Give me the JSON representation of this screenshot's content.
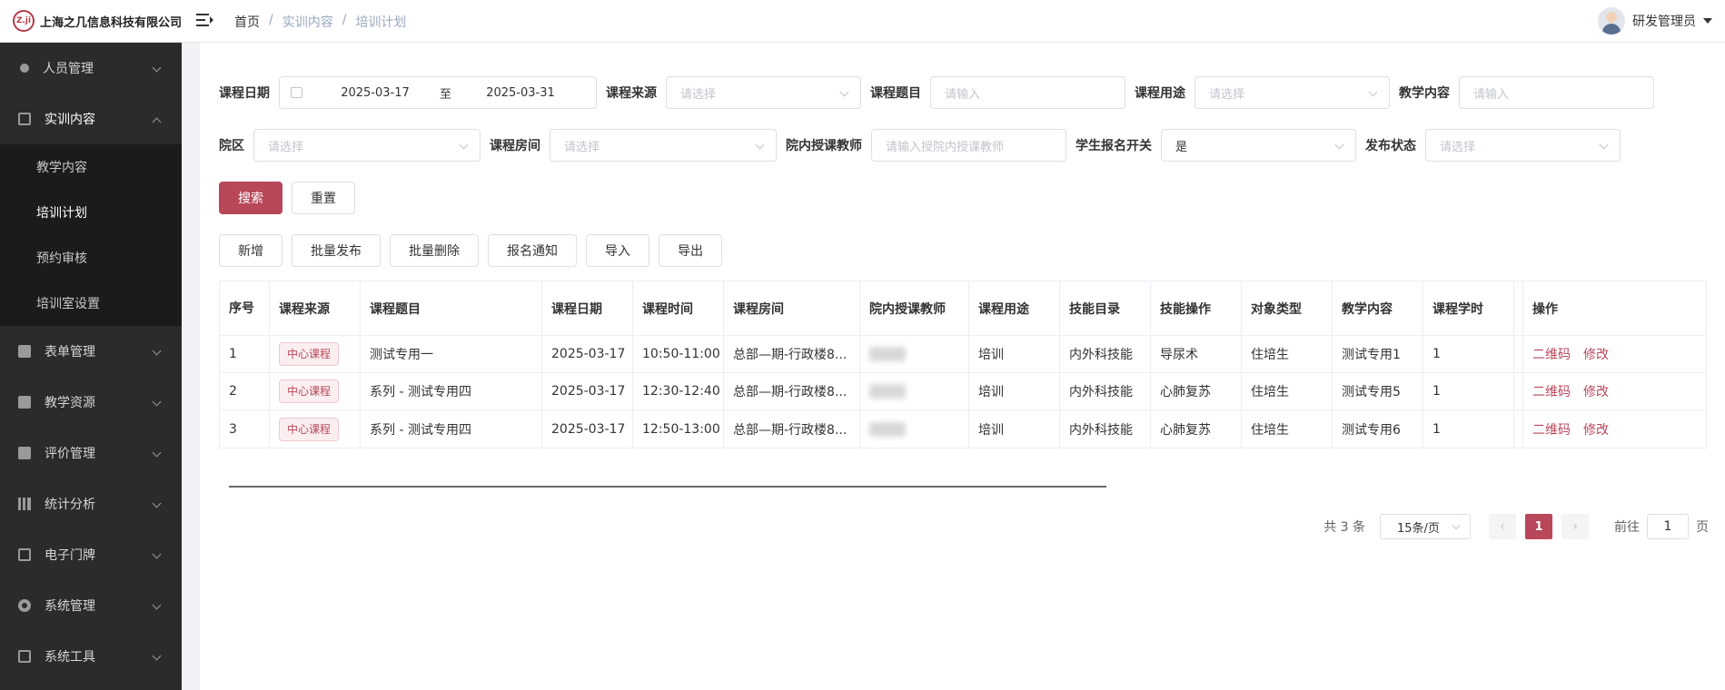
{
  "company": {
    "logo_mark": "Z.ji",
    "name": "上海之几信息科技有限公司"
  },
  "breadcrumb": {
    "home": "首页",
    "sep": "/",
    "mid": "实训内容",
    "current": "培训计划"
  },
  "user": {
    "name": "研发管理员"
  },
  "sidebar": {
    "items": [
      {
        "label": "人员管理"
      },
      {
        "label": "实训内容"
      },
      {
        "label": "表单管理"
      },
      {
        "label": "教学资源"
      },
      {
        "label": "评价管理"
      },
      {
        "label": "统计分析"
      },
      {
        "label": "电子门牌"
      },
      {
        "label": "系统管理"
      },
      {
        "label": "系统工具"
      }
    ],
    "submenu": [
      {
        "label": "教学内容"
      },
      {
        "label": "培训计划"
      },
      {
        "label": "预约审核"
      },
      {
        "label": "培训室设置"
      }
    ]
  },
  "filters": {
    "course_date_label": "课程日期",
    "date_start": "2025-03-17",
    "date_to": "至",
    "date_end": "2025-03-31",
    "source_label": "课程来源",
    "source_placeholder": "请选择",
    "title_label": "课程题目",
    "title_placeholder": "请输入",
    "purpose_label": "课程用途",
    "purpose_placeholder": "请选择",
    "content_label": "教学内容",
    "content_placeholder": "请输入",
    "campus_label": "院区",
    "campus_placeholder": "请选择",
    "room_label": "课程房间",
    "room_placeholder": "请选择",
    "teacher_label": "院内授课教师",
    "teacher_placeholder": "请输入授院内授课教师",
    "signup_label": "学生报名开关",
    "signup_value": "是",
    "status_label": "发布状态",
    "status_placeholder": "请选择"
  },
  "buttons": {
    "search": "搜索",
    "reset": "重置",
    "add": "新增",
    "batch_publish": "批量发布",
    "batch_delete": "批量删除",
    "signup_notice": "报名通知",
    "import": "导入",
    "export": "导出"
  },
  "table": {
    "headers": [
      "序号",
      "课程来源",
      "课程题目",
      "课程日期",
      "课程时间",
      "课程房间",
      "院内授课教师",
      "课程用途",
      "技能目录",
      "技能操作",
      "对象类型",
      "教学内容",
      "课程学时",
      "",
      "操作"
    ],
    "rows": [
      {
        "no": "1",
        "source": "中心课程",
        "title": "测试专用一",
        "date": "2025-03-17",
        "time": "10:50-11:00",
        "room": "总部—期-行政楼8...",
        "purpose": "培训",
        "skill_dir": "内外科技能",
        "skill_op": "导尿术",
        "target": "住培生",
        "content": "测试专用1",
        "hours": "1",
        "qr": "二维码",
        "edit": "修改"
      },
      {
        "no": "2",
        "source": "中心课程",
        "title": "系列 - 测试专用四",
        "date": "2025-03-17",
        "time": "12:30-12:40",
        "room": "总部—期-行政楼8...",
        "purpose": "培训",
        "skill_dir": "内外科技能",
        "skill_op": "心肺复苏",
        "target": "住培生",
        "content": "测试专用5",
        "hours": "1",
        "qr": "二维码",
        "edit": "修改"
      },
      {
        "no": "3",
        "source": "中心课程",
        "title": "系列 - 测试专用四",
        "date": "2025-03-17",
        "time": "12:50-13:00",
        "room": "总部—期-行政楼8...",
        "purpose": "培训",
        "skill_dir": "内外科技能",
        "skill_op": "心肺复苏",
        "target": "住培生",
        "content": "测试专用6",
        "hours": "1",
        "qr": "二维码",
        "edit": "修改"
      }
    ]
  },
  "pagination": {
    "total": "共 3 条",
    "page_size": "15条/页",
    "prev": "‹",
    "current": "1",
    "next": "›",
    "goto": "前往",
    "goto_value": "1",
    "page_unit": "页"
  },
  "colors": {
    "primary": "#b8475a",
    "sidebar_bg": "#2b2b2b",
    "submenu_bg": "#1b1b1b"
  }
}
